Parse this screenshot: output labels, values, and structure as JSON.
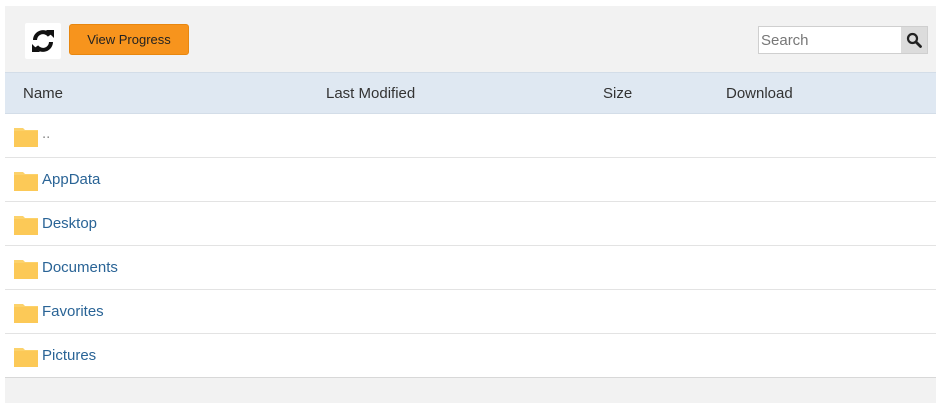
{
  "toolbar": {
    "refresh_icon": "refresh-icon",
    "view_progress_label": "View Progress"
  },
  "search": {
    "placeholder": "Search",
    "value": "",
    "icon": "search-icon"
  },
  "columns": [
    "Name",
    "Last Modified",
    "Size",
    "Download"
  ],
  "rows": [
    {
      "name": "..",
      "icon": "folder-icon"
    },
    {
      "name": "AppData",
      "icon": "folder-icon"
    },
    {
      "name": "Desktop",
      "icon": "folder-icon"
    },
    {
      "name": "Documents",
      "icon": "folder-icon"
    },
    {
      "name": "Favorites",
      "icon": "folder-icon"
    },
    {
      "name": "Pictures",
      "icon": "folder-icon"
    }
  ],
  "colors": {
    "accent": "#f7941d",
    "header_bg": "#dfe8f2",
    "link": "#2a6496",
    "folder": "#fcd26b"
  }
}
